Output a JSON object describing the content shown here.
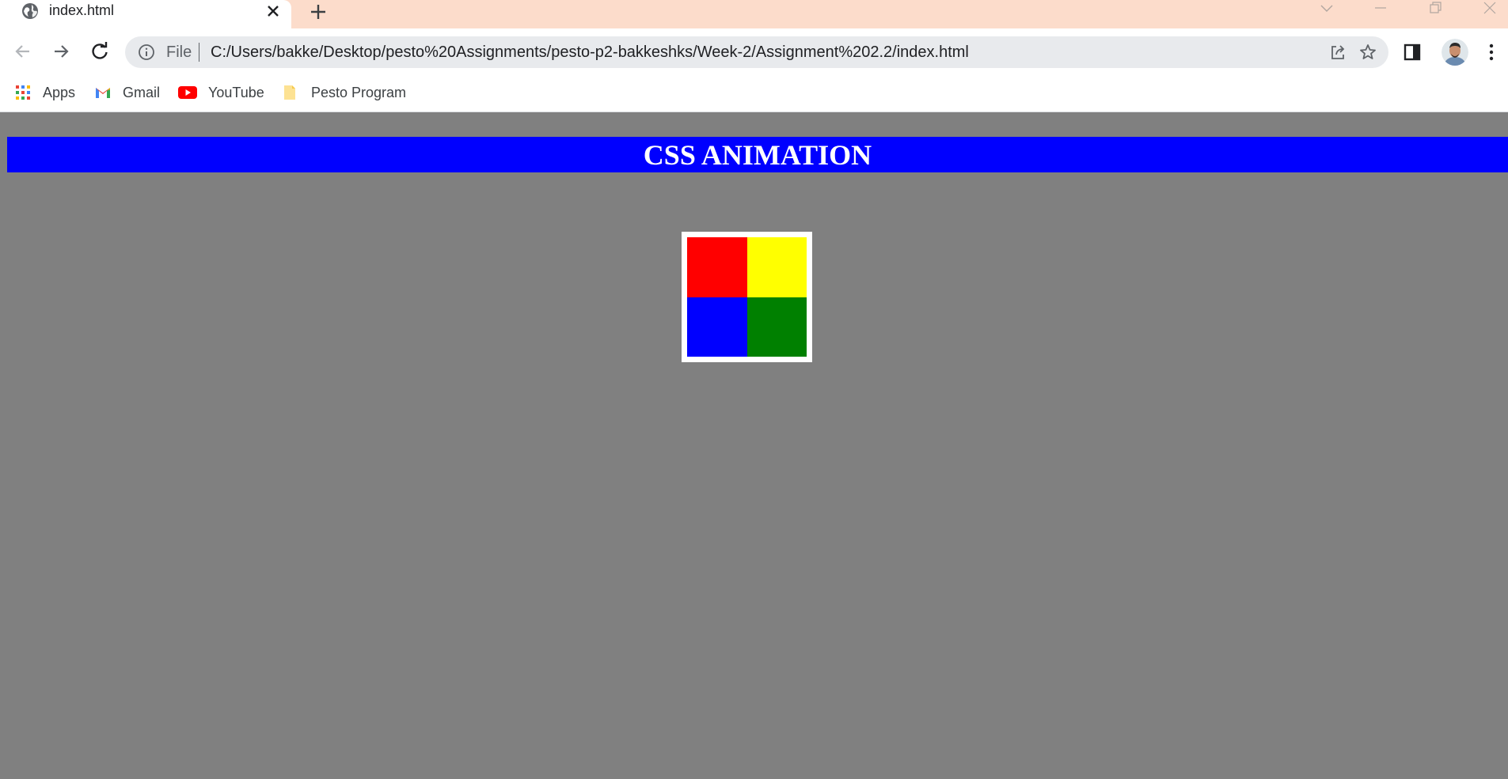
{
  "browser": {
    "tab": {
      "title": "index.html",
      "favicon": "globe-icon"
    },
    "new_tab_icon": "plus-icon",
    "window_controls": [
      "chevron-down-icon",
      "minimize-icon",
      "restore-icon",
      "close-icon"
    ],
    "toolbar": {
      "scheme_label": "File",
      "url": "C:/Users/bakke/Desktop/pesto%20Assignments/pesto-p2-bakkeshks/Week-2/Assignment%202.2/index.html"
    },
    "bookmarks": [
      {
        "label": "Apps",
        "icon": "apps-grid-icon"
      },
      {
        "label": "Gmail",
        "icon": "gmail-icon"
      },
      {
        "label": "YouTube",
        "icon": "youtube-icon"
      },
      {
        "label": "Pesto Program",
        "icon": "folder-icon"
      }
    ],
    "colors": {
      "tabstrip": "#fcdccb",
      "omnibox": "#e8eaed"
    }
  },
  "page": {
    "heading": "CSS ANIMATION",
    "colors": {
      "background": "#808080",
      "banner": "#0000ff",
      "squares": [
        "#ff0000",
        "#ffff00",
        "#0000ff",
        "#008000"
      ]
    }
  }
}
